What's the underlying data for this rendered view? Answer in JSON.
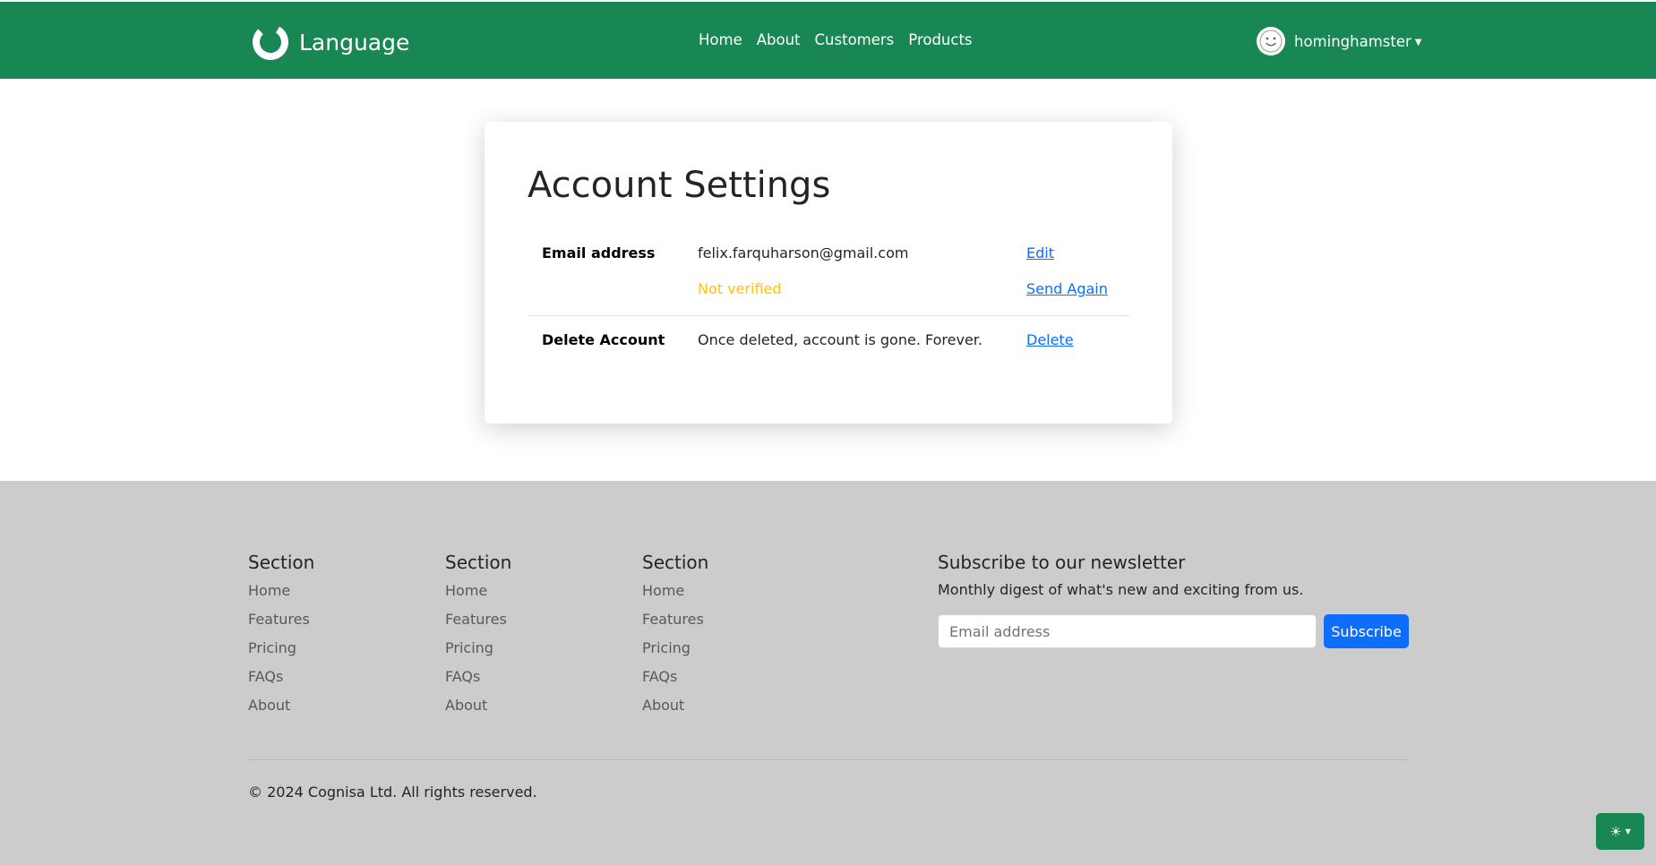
{
  "header": {
    "brand": "Language",
    "nav": [
      "Home",
      "About",
      "Customers",
      "Products"
    ],
    "username": "hominghamster"
  },
  "card": {
    "title": "Account Settings",
    "email_label": "Email address",
    "email_value": "felix.farquharson@gmail.com",
    "edit_label": "Edit",
    "verify_status": "Not verified",
    "send_again_label": "Send Again",
    "delete_label": "Delete Account",
    "delete_text": "Once deleted, account is gone. Forever.",
    "delete_link": "Delete"
  },
  "footer": {
    "columns": [
      {
        "title": "Section",
        "links": [
          "Home",
          "Features",
          "Pricing",
          "FAQs",
          "About"
        ]
      },
      {
        "title": "Section",
        "links": [
          "Home",
          "Features",
          "Pricing",
          "FAQs",
          "About"
        ]
      },
      {
        "title": "Section",
        "links": [
          "Home",
          "Features",
          "Pricing",
          "FAQs",
          "About"
        ]
      }
    ],
    "newsletter_title": "Subscribe to our newsletter",
    "newsletter_sub": "Monthly digest of what's new and exciting from us.",
    "email_placeholder": "Email address",
    "subscribe_label": "Subscribe",
    "copyright": "© 2024 Cognisa Ltd. All rights reserved."
  },
  "icons": {
    "logo": "ring-logo-icon",
    "avatar": "smiley-face-icon",
    "caret": "caret-down-icon",
    "theme": "sun-icon"
  },
  "colors": {
    "brand_green": "#198754",
    "link_blue": "#0d6efd",
    "warning_yellow": "#ffc107",
    "footer_gray": "#cccccc"
  }
}
